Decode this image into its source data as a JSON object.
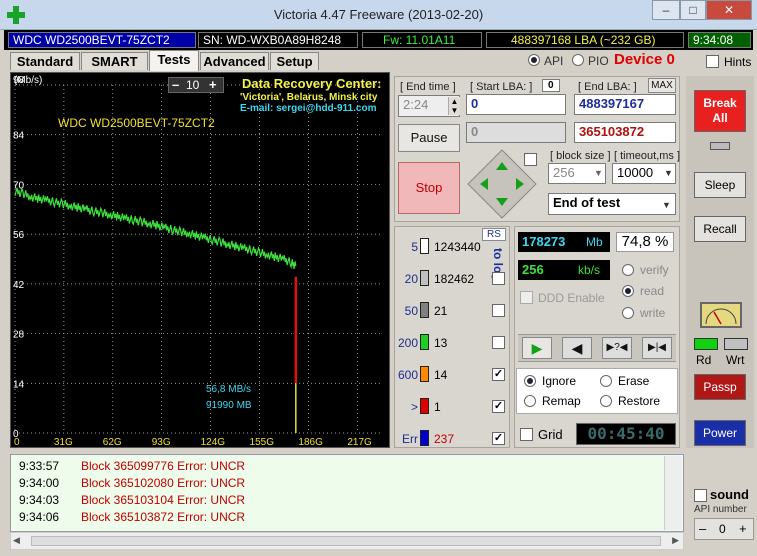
{
  "window": {
    "title": "Victoria 4.47  Freeware (2013-02-20)",
    "min": "–",
    "restore": "□",
    "close": "✕"
  },
  "infobar": {
    "model": "WDC WD2500BEVT-75ZCT2",
    "serial": "SN: WD-WXB0A89H8248",
    "firmware": "Fw: 11.01A11",
    "lba": "488397168 LBA (~232 GB)",
    "clock": "9:34:08"
  },
  "tabs": [
    "Standard",
    "SMART",
    "Tests",
    "Advanced",
    "Setup"
  ],
  "iface": {
    "api": "API",
    "pio": "PIO",
    "device": "Device 0",
    "hints": "Hints"
  },
  "chart": {
    "type": "line",
    "unit_label": "(Mb/s)",
    "zoom_minus": "–",
    "zoom_value": "10",
    "zoom_plus": "+",
    "model_label": "WDC WD2500BEVT-75ZCT2",
    "y_ticks": [
      "98",
      "84",
      "70",
      "56",
      "42",
      "28",
      "14",
      "0"
    ],
    "x_ticks": [
      "31G",
      "62G",
      "93G",
      "124G",
      "155G",
      "186G",
      "217G"
    ],
    "ylim": [
      0,
      98
    ],
    "xlim": [
      0,
      232
    ],
    "x": [
      0,
      5,
      10,
      15,
      20,
      25,
      30,
      35,
      40,
      45,
      50,
      55,
      60,
      65,
      70,
      75,
      80,
      85,
      90,
      95,
      100,
      105,
      110,
      115,
      120,
      125,
      130,
      135,
      140,
      145,
      150,
      155,
      160,
      165,
      170,
      175,
      178
    ],
    "values": [
      68,
      67.5,
      66.5,
      66,
      65.6,
      65,
      64.6,
      64,
      63.5,
      63,
      62.4,
      62,
      61.5,
      61,
      60.4,
      60,
      59.5,
      59,
      58.5,
      57.8,
      57.2,
      56.7,
      56.2,
      55.6,
      55,
      54.4,
      53.8,
      53.2,
      52.6,
      52,
      51.5,
      50.8,
      50.2,
      49.6,
      49,
      48,
      47
    ],
    "error_spike": {
      "x": 178,
      "top": 44,
      "bottom": 0
    },
    "speed_note": "56,8 MB/s",
    "size_note": "91990 MB",
    "recovery_title": "Data Recovery Center:",
    "recovery_line2": "'Victoria', Belarus, Minsk city",
    "recovery_line3": "E-mail: sergei@hdd-911.com"
  },
  "controls": {
    "end_time_label": "[ End time ]",
    "end_time_value": "2:24",
    "start_lba_label": "[ Start LBA: ]",
    "start_lba_value": "0",
    "start_lba_field": "0",
    "end_lba_label": "[ End LBA: ]",
    "end_lba_max": "MAX",
    "end_lba_value": "488397167",
    "pause": "Pause",
    "stop": "Stop",
    "current_lba_grey": "0",
    "current_lba": "365103872",
    "block_size_label": "[ block size ]",
    "block_size_value": "256",
    "timeout_label": "[ timeout,ms ]",
    "timeout_value": "10000",
    "end_action": "End of test"
  },
  "counts": {
    "rs": "RS",
    "to_log": "to log:",
    "rows": [
      {
        "label": "5",
        "count": "1243440",
        "color": "#ffffff"
      },
      {
        "label": "20",
        "count": "182462",
        "color": "#c0c0c0"
      },
      {
        "label": "50",
        "count": "21",
        "color": "#808080"
      },
      {
        "label": "200",
        "count": "13",
        "color": "#22cc22"
      },
      {
        "label": "600",
        "count": "14",
        "color": "#ff8800"
      },
      {
        "label": ">",
        "count": "1",
        "color": "#dd0000"
      },
      {
        "label": "Err",
        "count": "237",
        "color": "#0000cc"
      }
    ]
  },
  "status": {
    "mb_value": "178273",
    "mb_unit": "Mb",
    "percent": "74,8 %",
    "speed_value": "256",
    "speed_unit": "kb/s",
    "verify": "verify",
    "read": "read",
    "write": "write",
    "ddd": "DDD Enable",
    "play_icons": [
      "▶",
      "◀",
      "▶?◀",
      "▶|◀"
    ],
    "ignore": "Ignore",
    "erase": "Erase",
    "remap": "Remap",
    "restore": "Restore",
    "grid": "Grid",
    "timer": "00:45:40"
  },
  "side": {
    "break_all": "Break All",
    "sleep": "Sleep",
    "recall": "Recall",
    "rd": "Rd",
    "wrt": "Wrt",
    "passp": "Passp",
    "power": "Power",
    "sound": "sound",
    "api_number": "API number",
    "api_value": "0",
    "minus": "–",
    "plus": "+"
  },
  "log": [
    {
      "time": "9:33:57",
      "msg": "Block 365099776 Error: UNCR"
    },
    {
      "time": "9:34:00",
      "msg": "Block 365102080 Error: UNCR"
    },
    {
      "time": "9:34:03",
      "msg": "Block 365103104 Error: UNCR"
    },
    {
      "time": "9:34:06",
      "msg": "Block 365103872 Error: UNCR"
    }
  ]
}
